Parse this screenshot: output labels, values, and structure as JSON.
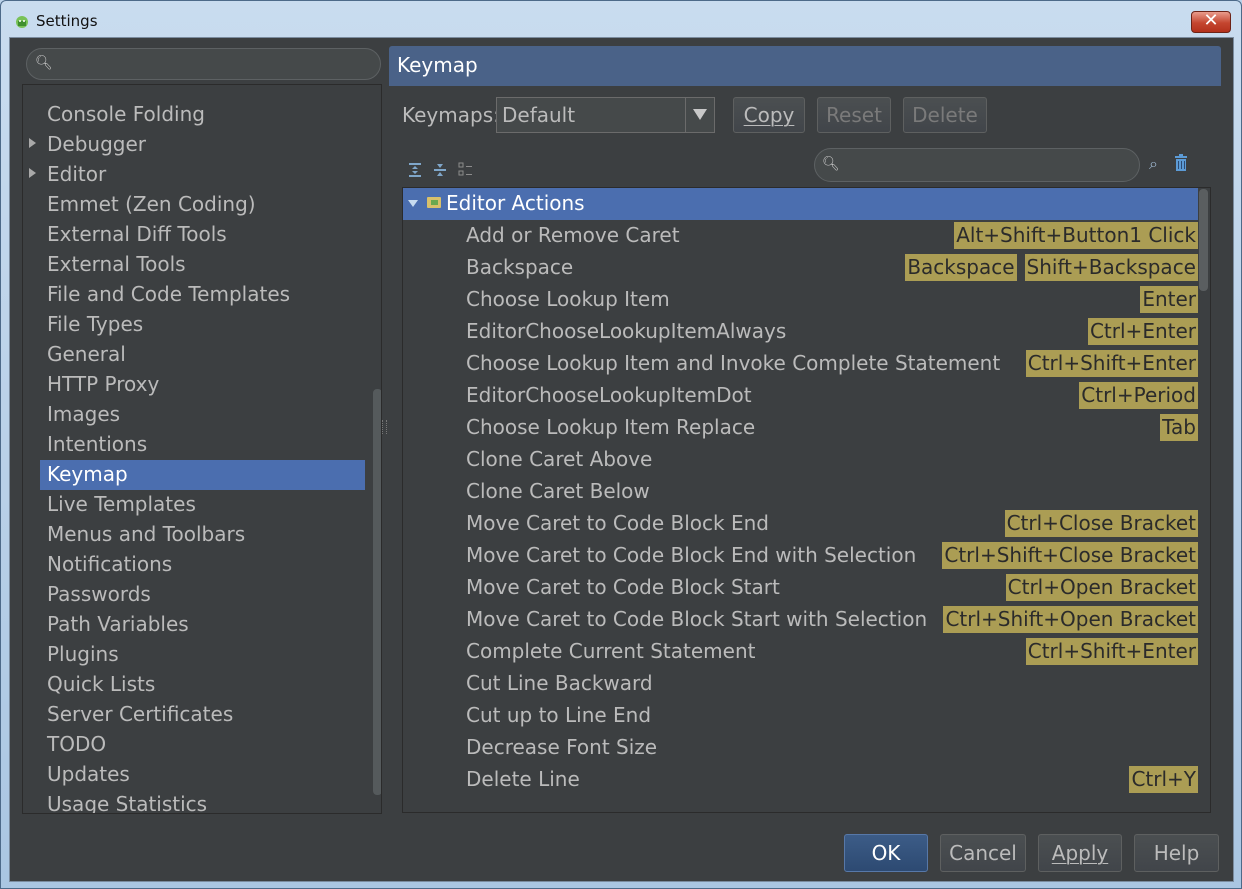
{
  "window": {
    "title": "Settings"
  },
  "sidebar": {
    "search": {
      "placeholder": ""
    },
    "items": [
      {
        "label": "Console Folding",
        "expandable": false
      },
      {
        "label": "Debugger",
        "expandable": true
      },
      {
        "label": "Editor",
        "expandable": true
      },
      {
        "label": "Emmet (Zen Coding)",
        "expandable": false
      },
      {
        "label": "External Diff Tools",
        "expandable": false
      },
      {
        "label": "External Tools",
        "expandable": false
      },
      {
        "label": "File and Code Templates",
        "expandable": false
      },
      {
        "label": "File Types",
        "expandable": false
      },
      {
        "label": "General",
        "expandable": false
      },
      {
        "label": "HTTP Proxy",
        "expandable": false
      },
      {
        "label": "Images",
        "expandable": false
      },
      {
        "label": "Intentions",
        "expandable": false
      },
      {
        "label": "Keymap",
        "expandable": false,
        "selected": true
      },
      {
        "label": "Live Templates",
        "expandable": false
      },
      {
        "label": "Menus and Toolbars",
        "expandable": false
      },
      {
        "label": "Notifications",
        "expandable": false
      },
      {
        "label": "Passwords",
        "expandable": false
      },
      {
        "label": "Path Variables",
        "expandable": false
      },
      {
        "label": "Plugins",
        "expandable": false
      },
      {
        "label": "Quick Lists",
        "expandable": false
      },
      {
        "label": "Server Certificates",
        "expandable": false
      },
      {
        "label": "TODO",
        "expandable": false
      },
      {
        "label": "Updates",
        "expandable": false
      },
      {
        "label": "Usage Statistics",
        "expandable": false
      }
    ]
  },
  "panel": {
    "title": "Keymap",
    "keymaps_label": "Keymaps:",
    "keymap_selected": "Default",
    "buttons": {
      "copy": "Copy",
      "reset": "Reset",
      "delete": "Delete"
    },
    "search": {
      "placeholder": ""
    },
    "tree": {
      "group": "Editor Actions",
      "actions": [
        {
          "name": "Add or Remove Caret",
          "shortcuts": [
            "Alt+Shift+Button1 Click"
          ]
        },
        {
          "name": "Backspace",
          "shortcuts": [
            "Backspace",
            "Shift+Backspace"
          ]
        },
        {
          "name": "Choose Lookup Item",
          "shortcuts": [
            "Enter"
          ]
        },
        {
          "name": "EditorChooseLookupItemAlways",
          "shortcuts": [
            "Ctrl+Enter"
          ]
        },
        {
          "name": "Choose Lookup Item and Invoke Complete Statement",
          "shortcuts": [
            "Ctrl+Shift+Enter"
          ]
        },
        {
          "name": "EditorChooseLookupItemDot",
          "shortcuts": [
            "Ctrl+Period"
          ]
        },
        {
          "name": "Choose Lookup Item Replace",
          "shortcuts": [
            "Tab"
          ]
        },
        {
          "name": "Clone Caret Above",
          "shortcuts": []
        },
        {
          "name": "Clone Caret Below",
          "shortcuts": []
        },
        {
          "name": "Move Caret to Code Block End",
          "shortcuts": [
            "Ctrl+Close Bracket"
          ]
        },
        {
          "name": "Move Caret to Code Block End with Selection",
          "shortcuts": [
            "Ctrl+Shift+Close Bracket"
          ]
        },
        {
          "name": "Move Caret to Code Block Start",
          "shortcuts": [
            "Ctrl+Open Bracket"
          ]
        },
        {
          "name": "Move Caret to Code Block Start with Selection",
          "shortcuts": [
            "Ctrl+Shift+Open Bracket"
          ]
        },
        {
          "name": "Complete Current Statement",
          "shortcuts": [
            "Ctrl+Shift+Enter"
          ]
        },
        {
          "name": "Cut Line Backward",
          "shortcuts": []
        },
        {
          "name": "Cut up to Line End",
          "shortcuts": []
        },
        {
          "name": "Decrease Font Size",
          "shortcuts": []
        },
        {
          "name": "Delete Line",
          "shortcuts": [
            "Ctrl+Y"
          ]
        }
      ]
    }
  },
  "footer": {
    "ok": "OK",
    "cancel": "Cancel",
    "apply": "Apply",
    "help": "Help"
  },
  "colors": {
    "accent": "#4b6eaf",
    "shortcut_bg": "#ab9d54",
    "background": "#3c3f41"
  }
}
